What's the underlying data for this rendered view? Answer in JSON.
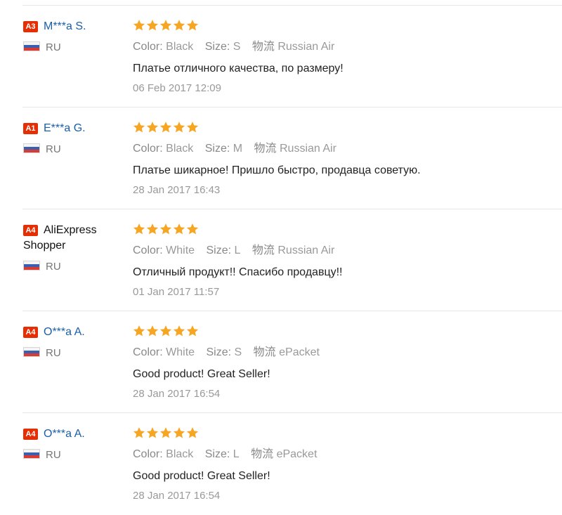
{
  "reviews": [
    {
      "badge": "A3",
      "name": "M***a S.",
      "name_color": "link",
      "country": "RU",
      "rating": 5,
      "color_label": "Color:",
      "color": "Black",
      "size_label": "Size:",
      "size": "S",
      "shipping_label": "物流",
      "shipping": "Russian Air",
      "text": "Платье отличного качества, по размеру!",
      "date": "06 Feb 2017 12:09"
    },
    {
      "badge": "A1",
      "name": "E***a G.",
      "name_color": "link",
      "country": "RU",
      "rating": 5,
      "color_label": "Color:",
      "color": "Black",
      "size_label": "Size:",
      "size": "M",
      "shipping_label": "物流",
      "shipping": "Russian Air",
      "text": "Платье шикарное! Пришло быстро, продавца советую.",
      "date": "28 Jan 2017 16:43"
    },
    {
      "badge": "A4",
      "name": "AliExpress Shopper",
      "name_color": "plain",
      "country": "RU",
      "rating": 5,
      "color_label": "Color:",
      "color": "White",
      "size_label": "Size:",
      "size": "L",
      "shipping_label": "物流",
      "shipping": "Russian Air",
      "text": "Отличный продукт!! Спасибо продавцу!!",
      "date": "01 Jan 2017 11:57"
    },
    {
      "badge": "A4",
      "name": "O***a A.",
      "name_color": "link",
      "country": "RU",
      "rating": 5,
      "color_label": "Color:",
      "color": "White",
      "size_label": "Size:",
      "size": "S",
      "shipping_label": "物流",
      "shipping": "ePacket",
      "text": "Good product! Great Seller!",
      "date": "28 Jan 2017 16:54"
    },
    {
      "badge": "A4",
      "name": "O***a A.",
      "name_color": "link",
      "country": "RU",
      "rating": 5,
      "color_label": "Color:",
      "color": "Black",
      "size_label": "Size:",
      "size": "L",
      "shipping_label": "物流",
      "shipping": "ePacket",
      "text": "Good product! Great Seller!",
      "date": "28 Jan 2017 16:54"
    }
  ],
  "colors": {
    "star": "#f6a623",
    "badge": "#e62e04",
    "link": "#1a5fa8"
  },
  "icons": {
    "star": "star-icon",
    "flag": "russia-flag-icon"
  }
}
